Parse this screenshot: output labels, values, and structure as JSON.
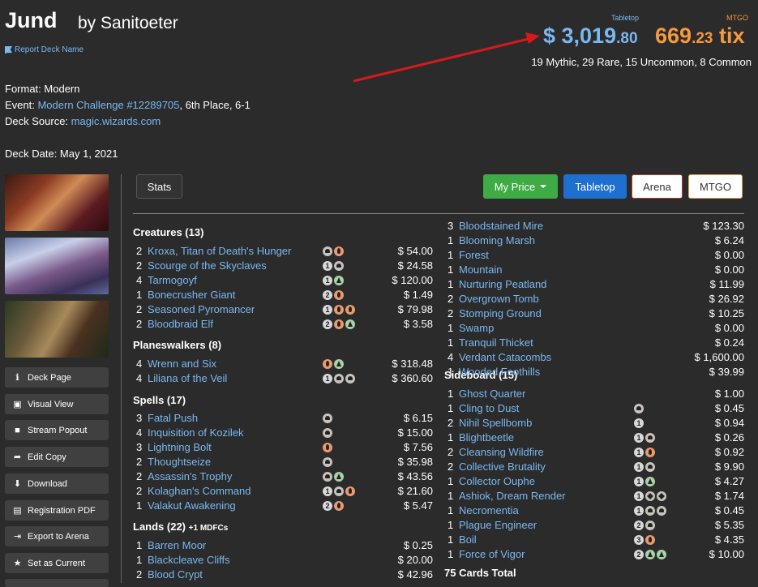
{
  "header": {
    "title": "Jund",
    "author": "by Sanitoeter",
    "report_link": "Report Deck Name",
    "tabletop_label": "Tabletop",
    "mtgo_label": "MTGO",
    "tabletop_price_main": "$ 3,019",
    "tabletop_price_cents": ".80",
    "mtgo_price_main": "669",
    "mtgo_price_cents": ".23",
    "mtgo_price_unit": " tix",
    "rarity_summary": "19 Mythic, 29 Rare, 15 Uncommon, 8 Common"
  },
  "meta": {
    "format_label": "Format: ",
    "format": "Modern",
    "event_label": "Event: ",
    "event": "Modern Challenge #12289705",
    "event_result": ", 6th Place, 6-1",
    "source_label": "Deck Source: ",
    "source": "magic.wizards.com",
    "date_label": "Deck Date: ",
    "date": "May 1, 2021"
  },
  "sidebar": {
    "buttons": [
      {
        "label": "Deck Page",
        "icon": "info-icon"
      },
      {
        "label": "Visual View",
        "icon": "image-icon"
      },
      {
        "label": "Stream Popout",
        "icon": "video-icon"
      },
      {
        "label": "Edit Copy",
        "icon": "share-icon"
      },
      {
        "label": "Download",
        "icon": "download-icon"
      },
      {
        "label": "Registration PDF",
        "icon": "pdf-icon"
      },
      {
        "label": "Export to Arena",
        "icon": "export-icon"
      },
      {
        "label": "Set as Current",
        "icon": "star-icon"
      }
    ]
  },
  "toolbar": {
    "stats": "Stats",
    "my_price": "My Price",
    "tabletop": "Tabletop",
    "arena": "Arena",
    "mtgo": "MTGO"
  },
  "colors": {
    "accent_blue": "#7ab8f0",
    "mtgo_orange": "#f39a3c",
    "green": "#3eab45",
    "blue_btn": "#1f6fd1"
  },
  "sections": {
    "creatures": "Creatures (13)",
    "planeswalkers": "Planeswalkers (8)",
    "spells": "Spells (17)",
    "lands": "Lands (22)",
    "lands_extra": "+1 MDFCs",
    "sideboard": "Sideboard (15)"
  },
  "creatures": [
    {
      "qty": "2",
      "name": "Kroxa, Titan of Death's Hunger",
      "mana": [
        "B",
        "R"
      ],
      "price": "$ 54.00"
    },
    {
      "qty": "2",
      "name": "Scourge of the Skyclaves",
      "mana": [
        "1",
        "B"
      ],
      "price": "$ 24.58"
    },
    {
      "qty": "4",
      "name": "Tarmogoyf",
      "mana": [
        "1",
        "G"
      ],
      "price": "$ 120.00"
    },
    {
      "qty": "1",
      "name": "Bonecrusher Giant",
      "mana": [
        "2",
        "R"
      ],
      "price": "$ 1.49"
    },
    {
      "qty": "2",
      "name": "Seasoned Pyromancer",
      "mana": [
        "1",
        "R",
        "R"
      ],
      "price": "$ 79.98"
    },
    {
      "qty": "2",
      "name": "Bloodbraid Elf",
      "mana": [
        "2",
        "R",
        "G"
      ],
      "price": "$ 3.58"
    }
  ],
  "planeswalkers": [
    {
      "qty": "4",
      "name": "Wrenn and Six",
      "mana": [
        "R",
        "G"
      ],
      "price": "$ 318.48"
    },
    {
      "qty": "4",
      "name": "Liliana of the Veil",
      "mana": [
        "1",
        "B",
        "B"
      ],
      "price": "$ 360.60"
    }
  ],
  "spells": [
    {
      "qty": "3",
      "name": "Fatal Push",
      "mana": [
        "B"
      ],
      "price": "$ 6.15"
    },
    {
      "qty": "4",
      "name": "Inquisition of Kozilek",
      "mana": [
        "B"
      ],
      "price": "$ 15.00"
    },
    {
      "qty": "3",
      "name": "Lightning Bolt",
      "mana": [
        "R"
      ],
      "price": "$ 7.56"
    },
    {
      "qty": "2",
      "name": "Thoughtseize",
      "mana": [
        "B"
      ],
      "price": "$ 35.98"
    },
    {
      "qty": "2",
      "name": "Assassin's Trophy",
      "mana": [
        "B",
        "G"
      ],
      "price": "$ 43.56"
    },
    {
      "qty": "2",
      "name": "Kolaghan's Command",
      "mana": [
        "1",
        "B",
        "R"
      ],
      "price": "$ 21.60"
    },
    {
      "qty": "1",
      "name": "Valakut Awakening",
      "mana": [
        "2",
        "R"
      ],
      "price": "$ 5.47"
    }
  ],
  "lands_left": [
    {
      "qty": "1",
      "name": "Barren Moor",
      "mana": [],
      "price": "$ 0.25"
    },
    {
      "qty": "1",
      "name": "Blackcleave Cliffs",
      "mana": [],
      "price": "$ 20.00"
    },
    {
      "qty": "2",
      "name": "Blood Crypt",
      "mana": [],
      "price": "$ 42.96"
    }
  ],
  "lands_right": [
    {
      "qty": "3",
      "name": "Bloodstained Mire",
      "price": "$ 123.30"
    },
    {
      "qty": "1",
      "name": "Blooming Marsh",
      "price": "$ 6.24"
    },
    {
      "qty": "1",
      "name": "Forest",
      "price": "$ 0.00"
    },
    {
      "qty": "1",
      "name": "Mountain",
      "price": "$ 0.00"
    },
    {
      "qty": "1",
      "name": "Nurturing Peatland",
      "price": "$ 11.99"
    },
    {
      "qty": "2",
      "name": "Overgrown Tomb",
      "price": "$ 26.92"
    },
    {
      "qty": "2",
      "name": "Stomping Ground",
      "price": "$ 10.25"
    },
    {
      "qty": "1",
      "name": "Swamp",
      "price": "$ 0.00"
    },
    {
      "qty": "1",
      "name": "Tranquil Thicket",
      "price": "$ 0.24"
    },
    {
      "qty": "4",
      "name": "Verdant Catacombs",
      "price": "$ 1,600.00"
    },
    {
      "qty": "1",
      "name": "Wooded Foothills",
      "price": "$ 39.99"
    }
  ],
  "sideboard": [
    {
      "qty": "1",
      "name": "Ghost Quarter",
      "mana": [],
      "price": "$ 1.00"
    },
    {
      "qty": "1",
      "name": "Cling to Dust",
      "mana": [
        "B"
      ],
      "price": "$ 0.45"
    },
    {
      "qty": "2",
      "name": "Nihil Spellbomb",
      "mana": [
        "1"
      ],
      "price": "$ 0.94"
    },
    {
      "qty": "1",
      "name": "Blightbeetle",
      "mana": [
        "1",
        "B"
      ],
      "price": "$ 0.26"
    },
    {
      "qty": "2",
      "name": "Cleansing Wildfire",
      "mana": [
        "1",
        "R"
      ],
      "price": "$ 0.92"
    },
    {
      "qty": "2",
      "name": "Collective Brutality",
      "mana": [
        "1",
        "B"
      ],
      "price": "$ 9.90"
    },
    {
      "qty": "1",
      "name": "Collector Ouphe",
      "mana": [
        "1",
        "G"
      ],
      "price": "$ 4.27"
    },
    {
      "qty": "1",
      "name": "Ashiok, Dream Render",
      "mana": [
        "1",
        "PB",
        "PB"
      ],
      "price": "$ 1.74"
    },
    {
      "qty": "1",
      "name": "Necromentia",
      "mana": [
        "1",
        "B",
        "B"
      ],
      "price": "$ 0.45"
    },
    {
      "qty": "1",
      "name": "Plague Engineer",
      "mana": [
        "2",
        "B"
      ],
      "price": "$ 5.35"
    },
    {
      "qty": "1",
      "name": "Boil",
      "mana": [
        "3",
        "R"
      ],
      "price": "$ 4.35"
    },
    {
      "qty": "1",
      "name": "Force of Vigor",
      "mana": [
        "2",
        "G",
        "G"
      ],
      "price": "$ 10.00"
    }
  ],
  "total": "75 Cards Total"
}
